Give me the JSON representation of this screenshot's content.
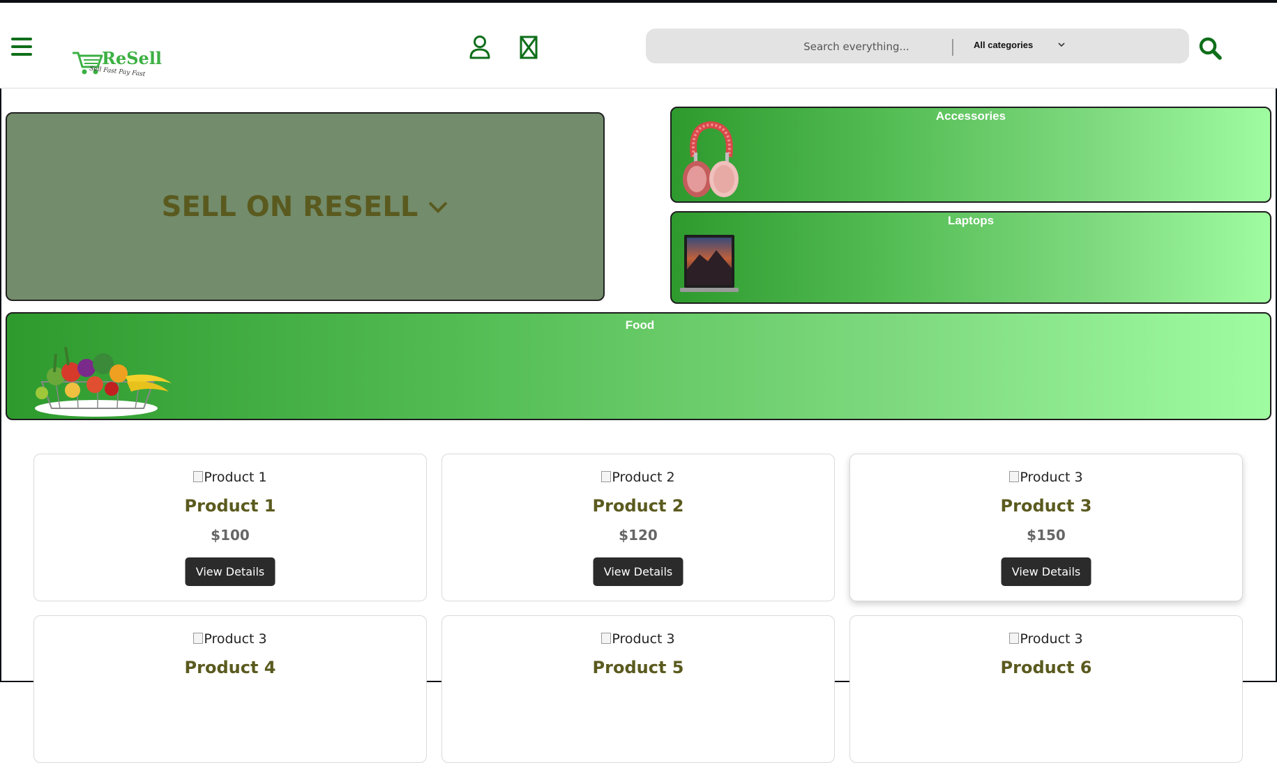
{
  "header": {
    "brand": "ReSell",
    "tagline": "Sell Fast Pay Fast",
    "search_placeholder": "Search everything...",
    "category_selected": "All categories"
  },
  "hero": {
    "sell_label": "SELL ON RESELL"
  },
  "categories": [
    {
      "name": "Accessories",
      "image_icon": "headphones-image"
    },
    {
      "name": "Laptops",
      "image_icon": "laptop-image"
    },
    {
      "name": "Food",
      "image_icon": "fruit-basket-image"
    }
  ],
  "products": [
    {
      "img_alt": "Product 1",
      "name": "Product 1",
      "price": "$100",
      "button": "View Details"
    },
    {
      "img_alt": "Product 2",
      "name": "Product 2",
      "price": "$120",
      "button": "View Details"
    },
    {
      "img_alt": "Product 3",
      "name": "Product 3",
      "price": "$150",
      "button": "View Details"
    },
    {
      "img_alt": "Product 3",
      "name": "Product 4"
    },
    {
      "img_alt": "Product 3",
      "name": "Product 5"
    },
    {
      "img_alt": "Product 3",
      "name": "Product 6"
    }
  ],
  "colors": {
    "brand_green": "#0f6e1a",
    "logo_green": "#3cb043",
    "hero_bg": "#738c6b",
    "hero_text": "#5a5a1f",
    "gradient_start": "#2e9a2e",
    "gradient_end": "#a0fca0",
    "button_dark": "#2b2b2b"
  }
}
